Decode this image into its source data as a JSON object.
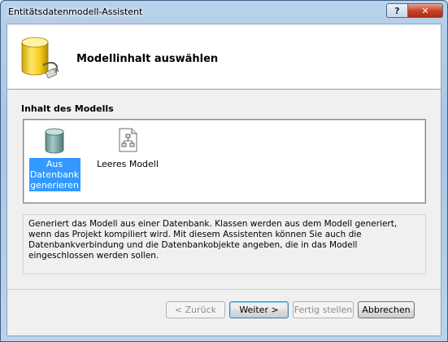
{
  "window": {
    "title": "Entitätsdatenmodell-Assistent",
    "help_glyph": "?",
    "close_glyph": "✕"
  },
  "header": {
    "title": "Modellinhalt auswählen",
    "icon": "database-plug-icon"
  },
  "model_contents": {
    "label": "Inhalt des Modells",
    "items": [
      {
        "label": "Aus Datenbank generieren",
        "icon": "database-icon",
        "selected": true
      },
      {
        "label": "Leeres Modell",
        "icon": "empty-model-icon",
        "selected": false
      }
    ]
  },
  "description": "Generiert das Modell aus einer Datenbank. Klassen werden aus dem Modell generiert, wenn das Projekt kompiliert wird. Mit diesem Assistenten können Sie auch die Datenbankverbindung und die Datenbankobjekte angeben, die in das Modell eingeschlossen werden sollen.",
  "buttons": {
    "back": "< Zurück",
    "next": "Weiter >",
    "finish": "Fertig stellen",
    "cancel": "Abbrechen"
  },
  "colors": {
    "selection": "#3399ff",
    "close_button": "#c7452a"
  }
}
